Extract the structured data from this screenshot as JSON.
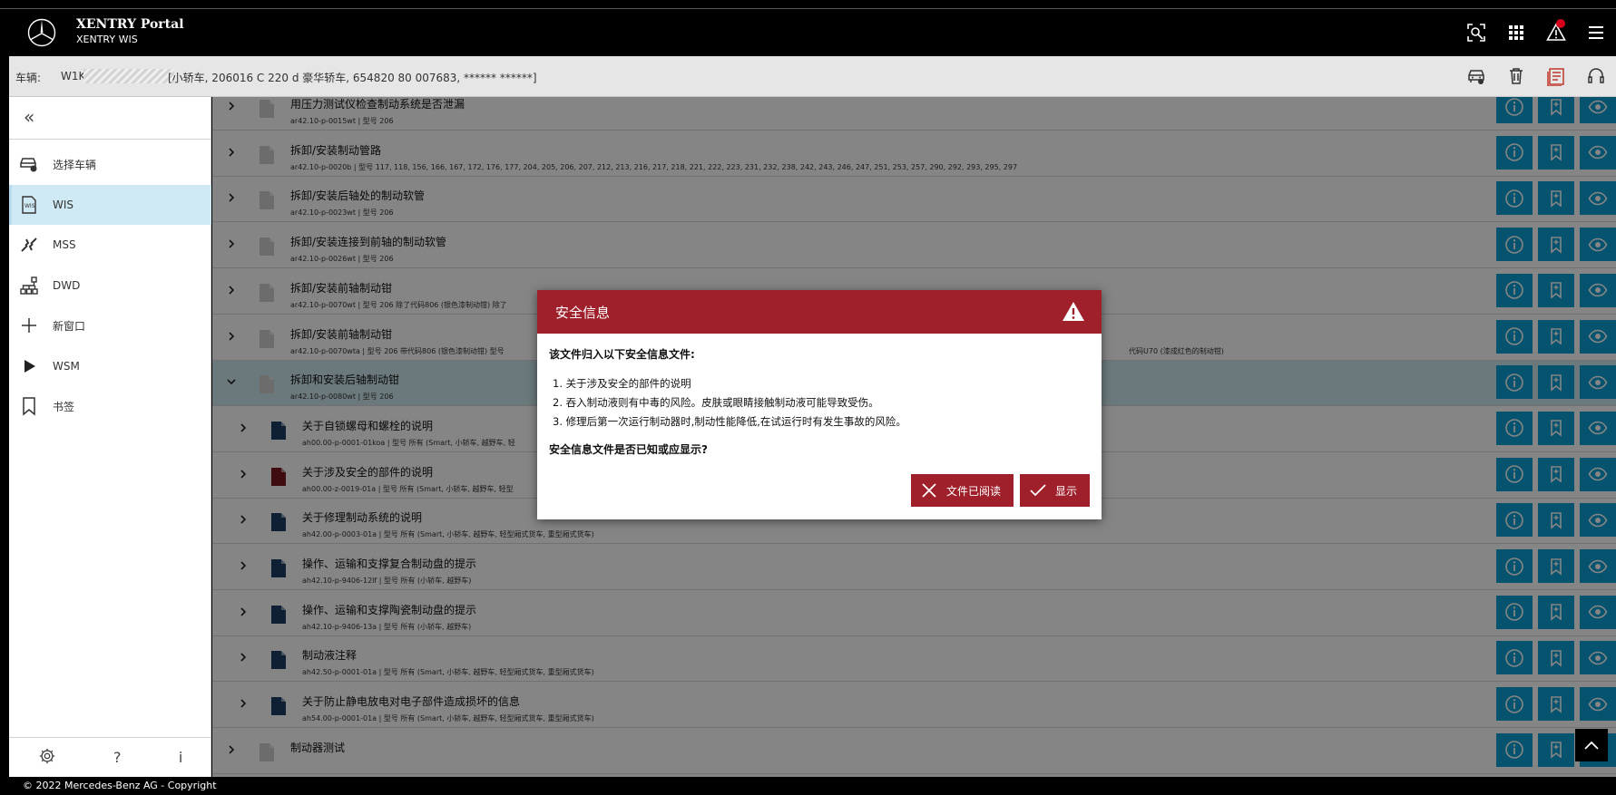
{
  "header": {
    "title": "XENTRY Portal",
    "subtitle": "XENTRY WIS",
    "icons": [
      "scan-icon",
      "apps-grid-icon",
      "warning-icon",
      "menu-icon"
    ]
  },
  "vehicle_bar": {
    "label": "车辆:",
    "vin_prefix": "W1K",
    "description": "[小轿车, 206016 C 220 d 豪华轿车, 654820 80 007683, ****** ******]",
    "icons": [
      "car-icon",
      "trash-icon",
      "report-icon",
      "headset-icon"
    ]
  },
  "sidebar": {
    "collapse_icon": "«",
    "items": [
      {
        "label": "选择车辆",
        "icon": "car-search-icon"
      },
      {
        "label": "WIS",
        "icon": "wis-doc-icon",
        "active": true
      },
      {
        "label": "MSS",
        "icon": "mss-icon"
      },
      {
        "label": "DWD",
        "icon": "network-icon"
      },
      {
        "label": "新窗口",
        "icon": "plus-icon"
      },
      {
        "label": "WSM",
        "icon": "play-icon"
      },
      {
        "label": "书签",
        "icon": "bookmark-icon"
      }
    ],
    "footer": {
      "help": "?",
      "info": "i"
    }
  },
  "documents": [
    {
      "title": "用压力测试仪检查制动系统是否泄漏",
      "sub": "ar42.10-p-0015wt | 型号 206",
      "doc": "gray",
      "level": 0
    },
    {
      "title": "拆卸/安装制动管路",
      "sub": "ar42.10-p-0020b | 型号 117, 118, 156, 166, 167, 172, 176, 177, 204, 205, 206, 207, 212, 213, 216, 217, 218, 221, 222, 223, 231, 232, 238, 242, 243, 246, 247, 251, 253, 257, 290, 292, 293, 295, 297",
      "doc": "gray",
      "level": 0
    },
    {
      "title": "拆卸/安装后轴处的制动软管",
      "sub": "ar42.10-p-0023wt | 型号 206",
      "doc": "gray",
      "level": 0
    },
    {
      "title": "拆卸/安装连接到前轴的制动软管",
      "sub": "ar42.10-p-0026wt | 型号 206",
      "doc": "gray",
      "level": 0
    },
    {
      "title": "拆卸/安装前轴制动钳",
      "sub": "ar42.10-p-0070wt | 型号 206 除了代码806 (银色漆制动钳) 除了",
      "doc": "gray",
      "level": 0
    },
    {
      "title": "拆卸/安装前轴制动钳",
      "sub": "ar42.10-p-0070wta | 型号 206 带代码806 (银色漆制动钳) 型号",
      "sub_right": "代码U70 (漆成红色的制动钳)",
      "doc": "gray",
      "level": 0
    },
    {
      "title": "拆卸和安装后轴制动钳",
      "sub": "ar42.10-p-0080wt | 型号 206",
      "doc": "gray",
      "level": 0,
      "expanded": true
    },
    {
      "title": "关于自锁螺母和螺栓的说明",
      "sub": "ah00.00-p-0001-01koa | 型号 所有 (Smart, 小轿车, 越野车, 轻",
      "doc": "blue",
      "level": 1
    },
    {
      "title": "关于涉及安全的部件的说明",
      "sub": "ah00.00-z-0019-01a | 型号 所有 (Smart, 小轿车, 越野车, 轻型",
      "doc": "red",
      "level": 1
    },
    {
      "title": "关于修理制动系统的说明",
      "sub": "ah42.00-p-0003-01a | 型号 所有 (Smart, 小轿车, 越野车, 轻型厢式货车, 重型厢式货车)",
      "doc": "blue",
      "level": 1
    },
    {
      "title": "操作、运输和支撑复合制动盘的提示",
      "sub": "ah42.10-p-9406-12lf | 型号 所有 (小轿车, 越野车)",
      "doc": "blue",
      "level": 1
    },
    {
      "title": "操作、运输和支撑陶瓷制动盘的提示",
      "sub": "ah42.10-p-9406-13a | 型号 所有 (小轿车, 越野车)",
      "doc": "blue",
      "level": 1
    },
    {
      "title": "制动液注释",
      "sub": "ah42.50-p-0001-01a | 型号 所有 (Smart, 小轿车, 越野车, 轻型厢式货车, 重型厢式货车)",
      "doc": "blue",
      "level": 1
    },
    {
      "title": "关于防止静电放电对电子部件造成损坏的信息",
      "sub": "ah54.00-p-0001-01a | 型号 所有 (Smart, 小轿车, 越野车, 轻型厢式货车, 重型厢式货车)",
      "doc": "blue",
      "level": 1
    },
    {
      "title": "制动器测试",
      "sub": "",
      "doc": "gray",
      "level": 0
    }
  ],
  "modal": {
    "title": "安全信息",
    "intro": "该文件归入以下安全信息文件:",
    "items": [
      "1. 关于涉及安全的部件的说明",
      "2. 吞入制动液则有中毒的风险。皮肤或眼睛接触制动液可能导致受伤。",
      "3. 修理后第一次运行制动器时,制动性能降低,在试运行时有发生事故的风险。"
    ],
    "question": "安全信息文件是否已知或应显示?",
    "btn_read": "文件已阅读",
    "btn_show": "显示"
  },
  "footer": {
    "copyright": "© 2022 Mercedes-Benz AG - Copyright"
  },
  "colors": {
    "accent": "#0aa0d5",
    "danger": "#9f1f2a",
    "selected_row": "#cde8ee",
    "active_nav": "#cfeaf5"
  }
}
